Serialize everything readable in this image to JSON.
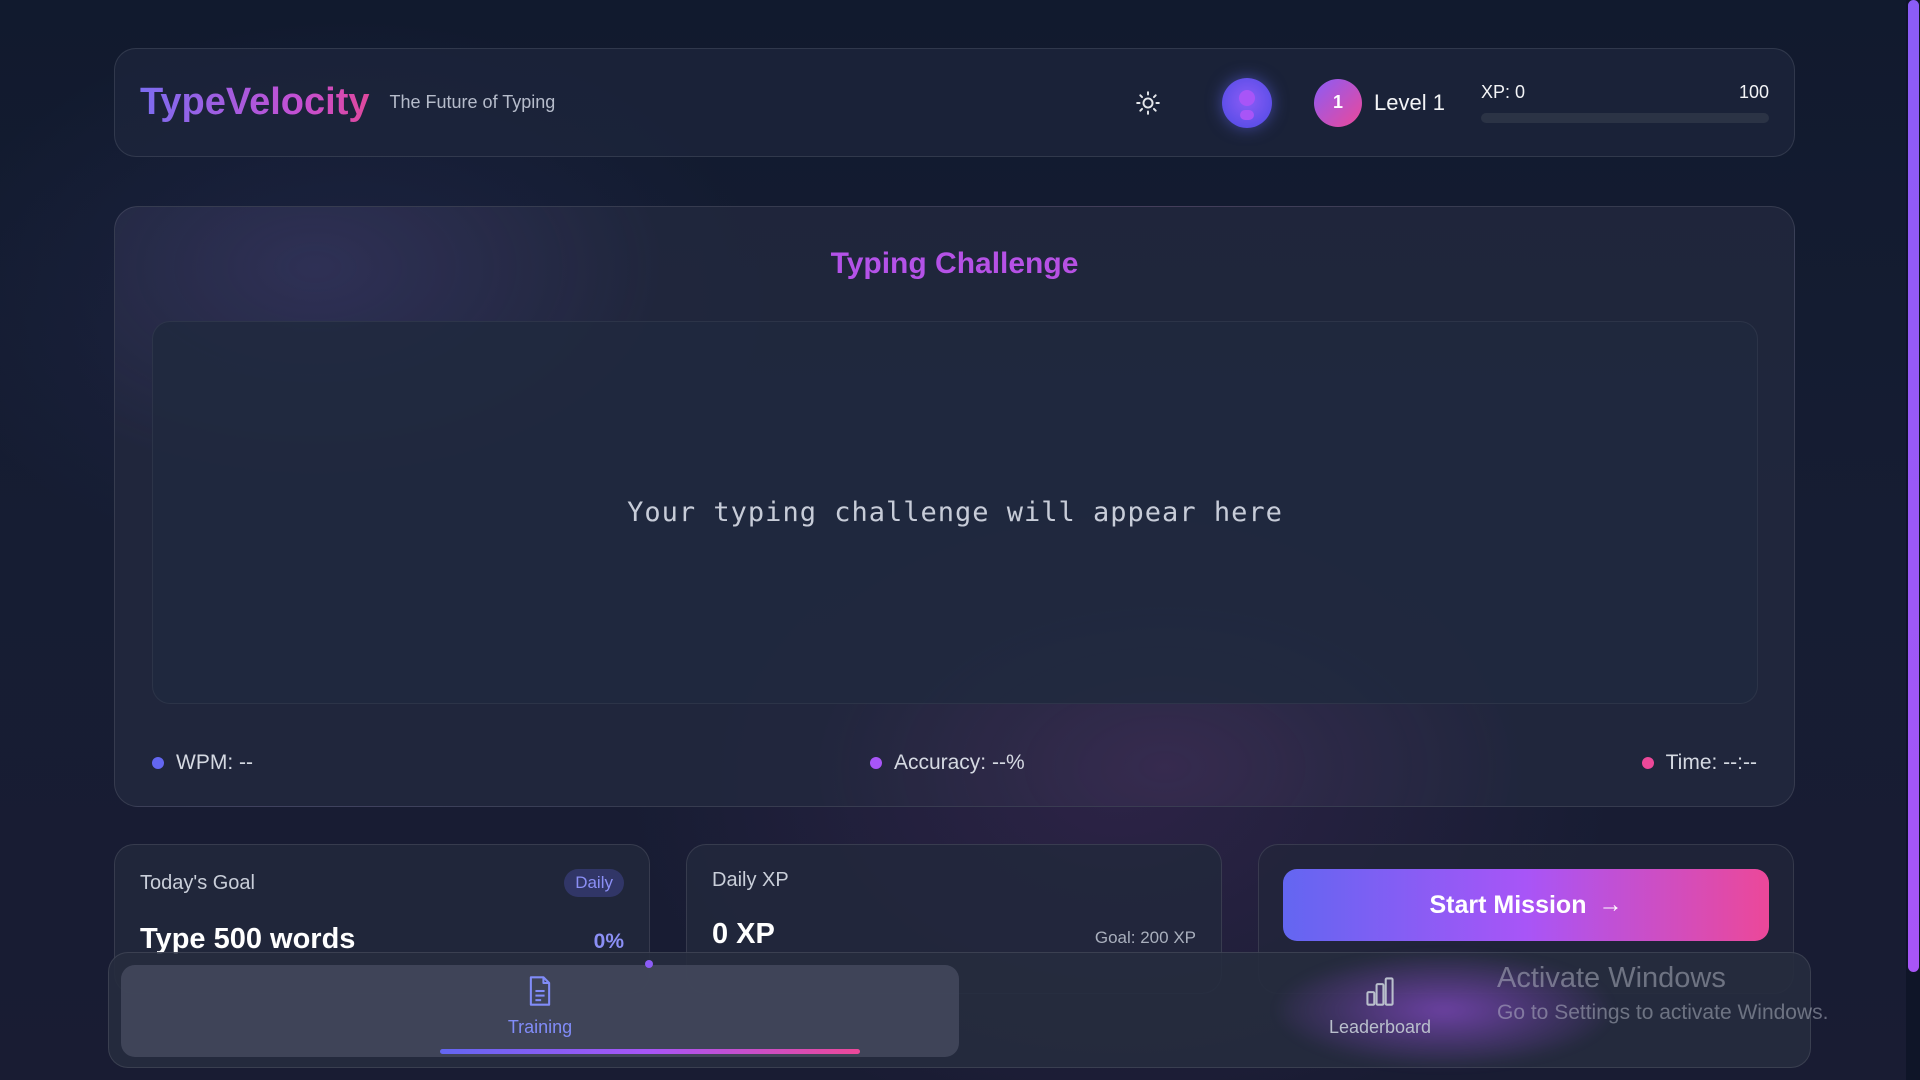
{
  "header": {
    "brand": "TypeVelocity",
    "tagline": "The Future of Typing",
    "level_number": "1",
    "level_label": "Level 1",
    "xp_label": "XP: 0",
    "xp_max": "100",
    "xp_progress": 0
  },
  "challenge": {
    "title": "Typing Challenge",
    "placeholder": "Your typing challenge will appear here",
    "stats": {
      "wpm": "WPM: --",
      "accuracy": "Accuracy: --%",
      "time": "Time: --:--"
    }
  },
  "cards": {
    "goal": {
      "title": "Today's Goal",
      "badge": "Daily",
      "value": "Type 500 words",
      "percent": "0%"
    },
    "xp": {
      "title": "Daily XP",
      "value": "0 XP",
      "goal": "Goal: 200 XP"
    },
    "mission": {
      "button": "Start Mission"
    }
  },
  "nav": {
    "items": [
      {
        "label": "Training",
        "icon": "document-icon",
        "active": true
      },
      {
        "label": "Leaderboard",
        "icon": "bar-chart-icon",
        "active": false
      }
    ]
  },
  "watermark": {
    "title": "Activate Windows",
    "subtitle": "Go to Settings to activate Windows."
  },
  "colors": {
    "accent_indigo": "#6366f1",
    "accent_purple": "#a855f7",
    "accent_pink": "#ec4899",
    "background": "#161d33"
  }
}
